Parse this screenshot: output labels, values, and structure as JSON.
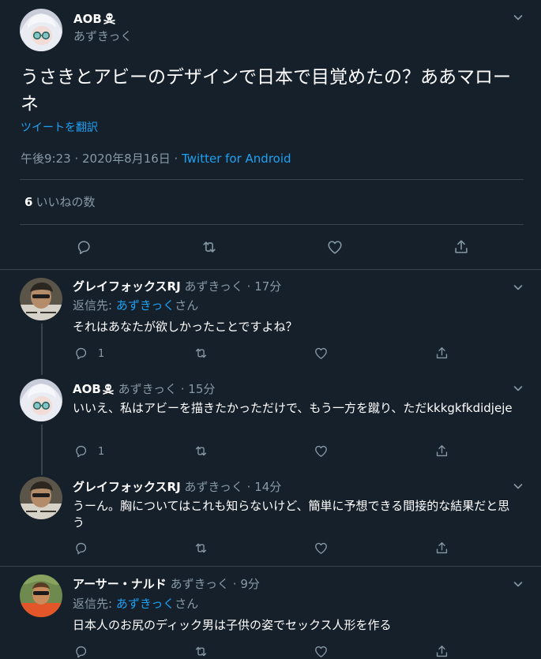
{
  "main_tweet": {
    "author_name": "AOB",
    "author_handle": "あずきっく",
    "text": "うさきとアビーのデザインで日本で目覚めたの？ああマローネ",
    "translate_link": "ツイートを翻訳",
    "timestamp": "午後9:23 · 2020年8月16日 · ",
    "source": "Twitter for Android",
    "likes_count": "6",
    "likes_label": "いいねの数"
  },
  "replies": [
    {
      "name": "グレイフォックスRJ",
      "handle": "あずきっく",
      "time": "· 17分",
      "reply_prefix": "返信先: ",
      "reply_to": "あずきっく",
      "reply_suffix": "さん",
      "text": "それはあなたが欲しかったことですよね？",
      "reply_count": "1"
    },
    {
      "name": "AOB",
      "handle": "あずきっく",
      "time": "· 15分",
      "text": "いいえ、私はアビーを描きたかっただけで、もう一方を蹴り、ただkkkgkfkdidjeje",
      "reply_count": "1"
    },
    {
      "name": "グレイフォックスRJ",
      "handle": "あずきっく",
      "time": "· 14分",
      "text": "うーん。胸についてはこれも知らないけど、簡単に予想できる間接的な結果だと思う",
      "reply_count": ""
    },
    {
      "name": "アーサー・ナルド",
      "handle": "あずきっく",
      "time": "· 9分",
      "reply_prefix": "返信先: ",
      "reply_to": "あずきっく",
      "reply_suffix": "さん",
      "text": "日本人のお尻のディック男は子供の姿でセックス人形を作る",
      "reply_count": ""
    }
  ],
  "colors": {
    "background": "#15202b",
    "text": "#ffffff",
    "muted": "#8899a6",
    "link": "#1da1f2",
    "divider": "#38444d"
  },
  "icons": [
    "chevron-down-icon",
    "reply-icon",
    "retweet-icon",
    "like-icon",
    "share-icon",
    "skull-crossbones-icon"
  ]
}
